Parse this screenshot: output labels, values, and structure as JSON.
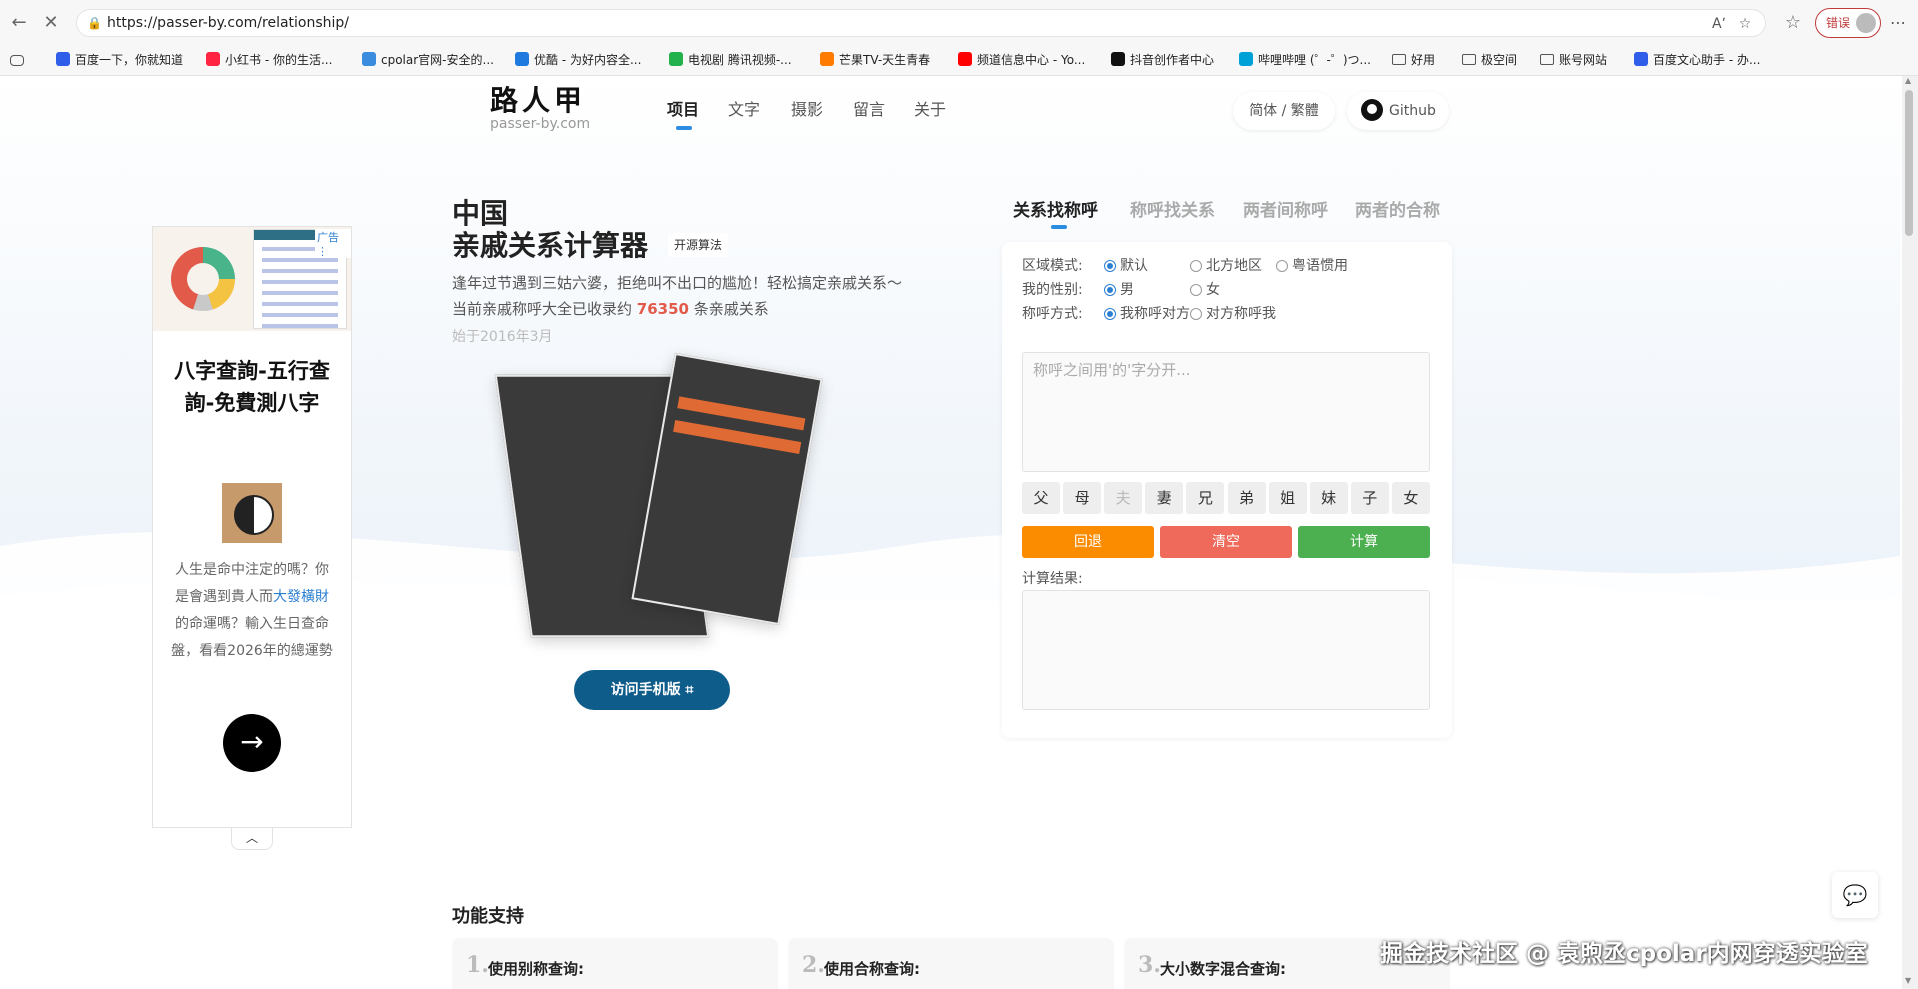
{
  "browser": {
    "url": "https://passer-by.com/relationship/",
    "error_label": "错误",
    "bookmarks": [
      {
        "label": "百度一下，你就知道",
        "color": "#2f5ee8"
      },
      {
        "label": "小红书 - 你的生活...",
        "color": "#ff2442"
      },
      {
        "label": "cpolar官网-安全的...",
        "color": "#3a8dde"
      },
      {
        "label": "优酷 - 为好内容全...",
        "color": "#1f7ae0"
      },
      {
        "label": "电视剧 腾讯视频-...",
        "color": "#22b14c"
      },
      {
        "label": "芒果TV-天生青春",
        "color": "#ff7a00"
      },
      {
        "label": "频道信息中心 - Yo...",
        "color": "#ff0000"
      },
      {
        "label": "抖音创作者中心",
        "color": "#111111"
      },
      {
        "label": "哔哩哔哩 (゜-゜)つ...",
        "color": "#00a1d6"
      },
      {
        "label": "好用",
        "folder": true
      },
      {
        "label": "极空间",
        "folder": true
      },
      {
        "label": "账号网站",
        "folder": true
      },
      {
        "label": "百度文心助手 - 办...",
        "color": "#2f5ee8"
      }
    ]
  },
  "site": {
    "logo_cn": "路人甲",
    "logo_en": "passer-by.com",
    "nav": [
      {
        "label": "项目",
        "active": true
      },
      {
        "label": "文字"
      },
      {
        "label": "摄影"
      },
      {
        "label": "留言"
      },
      {
        "label": "关于"
      }
    ],
    "lang_switch": "简体 / 繁體",
    "github_label": "Github"
  },
  "ad": {
    "label": "广告",
    "title": "八字查詢-五行查詢-免費測八字",
    "desc_before": "人生是命中注定的嗎？你是會遇到貴人而",
    "desc_link": "大發橫財",
    "desc_after": "的命運嗎？輸入生日查命盤，看看2026年的總運勢"
  },
  "hero": {
    "title_line1": "中国",
    "title_line2": "亲戚关系计算器",
    "badge": "开源算法",
    "line1": "逢年过节遇到三姑六婆，拒绝叫不出口的尴尬！轻松搞定亲戚关系～",
    "line2_prefix": "当前亲戚称呼大全已收录约",
    "line2_count": "76350",
    "line2_suffix": "条亲戚关系",
    "since": "始于2016年3月",
    "mobile_button": "访问手机版"
  },
  "calculator": {
    "tabs": [
      "关系找称呼",
      "称呼找关系",
      "两者间称呼",
      "两者的合称"
    ],
    "region_label": "区域模式:",
    "region_options": [
      {
        "label": "默认",
        "checked": true
      },
      {
        "label": "北方地区",
        "checked": false
      },
      {
        "label": "粤语惯用",
        "checked": false
      }
    ],
    "gender_label": "我的性别:",
    "gender_options": [
      {
        "label": "男",
        "checked": true
      },
      {
        "label": "女",
        "checked": false
      }
    ],
    "mode_label": "称呼方式:",
    "mode_options": [
      {
        "label": "我称呼对方",
        "checked": true
      },
      {
        "label": "对方称呼我",
        "checked": false
      }
    ],
    "input_placeholder": "称呼之间用'的'字分开...",
    "keys": [
      {
        "label": "父"
      },
      {
        "label": "母"
      },
      {
        "label": "夫",
        "disabled": true
      },
      {
        "label": "妻"
      },
      {
        "label": "兄"
      },
      {
        "label": "弟"
      },
      {
        "label": "姐"
      },
      {
        "label": "妹"
      },
      {
        "label": "子"
      },
      {
        "label": "女"
      }
    ],
    "back_button": "回退",
    "clear_button": "清空",
    "calc_button": "计算",
    "result_label": "计算结果:",
    "colors": {
      "back": "#fb8c00",
      "clear": "#ef6a5a",
      "calc": "#4caf50"
    }
  },
  "features": {
    "title": "功能支持",
    "items": [
      {
        "num": "1.",
        "label": "使用别称查询:"
      },
      {
        "num": "2.",
        "label": "使用合称查询:"
      },
      {
        "num": "3.",
        "label": "大小数字混合查询:"
      }
    ]
  },
  "watermark": "掘金技术社区 @ 袁煦丞cpolar内网穿透实验室"
}
